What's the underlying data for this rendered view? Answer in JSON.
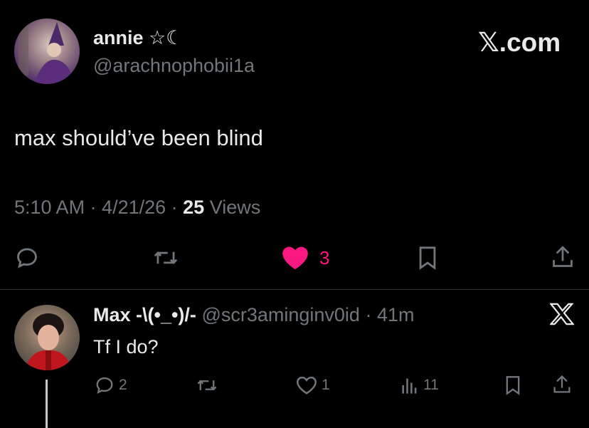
{
  "post": {
    "author_name": "annie ☆☾",
    "author_handle": "@arachnophobii1a",
    "text": "max should’ve been blind",
    "meta_time": "5:10 AM · 4/21/26 ·",
    "views_count": "25",
    "views_label": "Views",
    "like_count": "3",
    "liked": true,
    "brand": "𝕏.com"
  },
  "reply": {
    "author_name": "Max -\\(•_•)/-",
    "author_handle": "@scr3aminginv0id",
    "time": "· 41m",
    "text": "Tf I do?",
    "reply_count": "2",
    "like_count": "1",
    "views_count": "11"
  },
  "colors": {
    "like_pink": "#f91880",
    "muted": "#71767b",
    "text": "#e7e9ea",
    "divider": "#2f3336"
  },
  "icons": [
    "reply-icon",
    "repost-icon",
    "heart-icon",
    "bookmark-icon",
    "share-icon",
    "views-icon",
    "x-logo-icon"
  ]
}
